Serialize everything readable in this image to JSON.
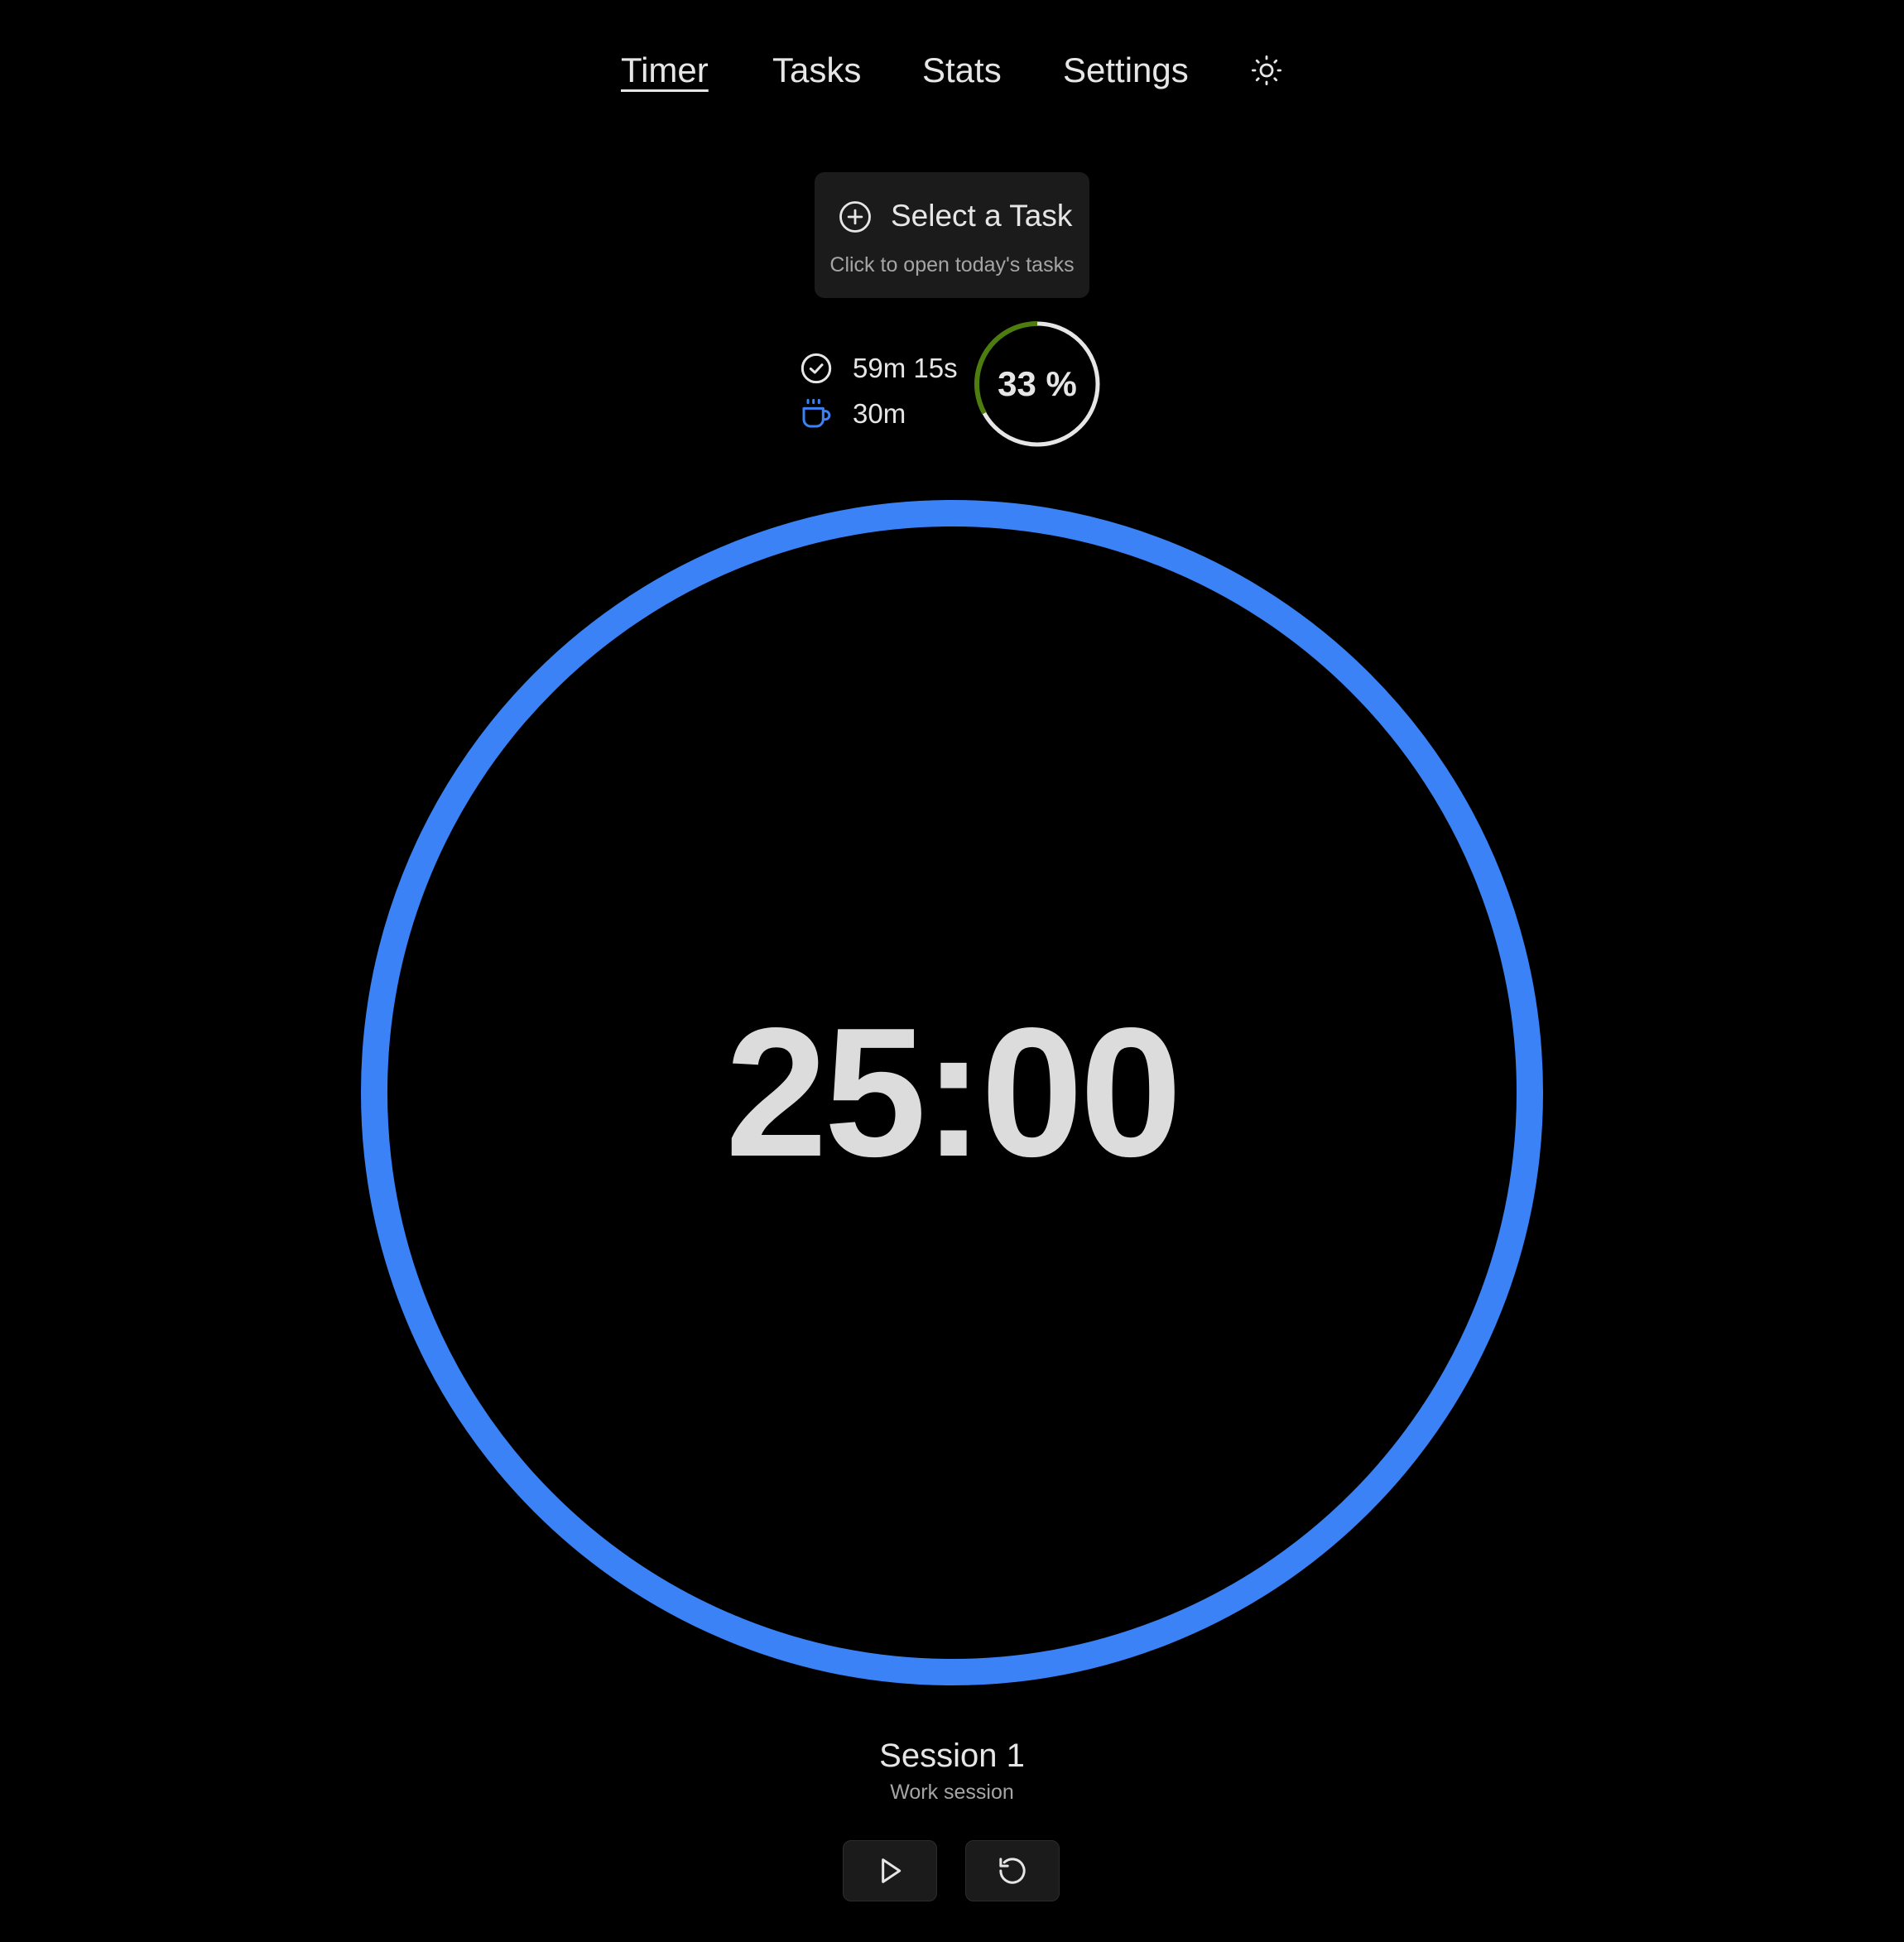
{
  "nav": {
    "items": [
      {
        "label": "Timer",
        "active": true
      },
      {
        "label": "Tasks",
        "active": false
      },
      {
        "label": "Stats",
        "active": false
      },
      {
        "label": "Settings",
        "active": false
      }
    ],
    "theme_icon": "sun-icon"
  },
  "task_selector": {
    "title": "Select a Task",
    "subtitle": "Click to open today's tasks",
    "icon": "plus-circle-icon"
  },
  "stats": {
    "focus_time": "59m 15s",
    "focus_icon": "check-circle-icon",
    "break_time": "30m",
    "break_icon": "coffee-cup-icon",
    "progress_label": "33 %",
    "progress_fraction": 0.33,
    "progress_color": "#4d7c0f",
    "ring_color": "#e6e6e6"
  },
  "timer": {
    "display": "25:00",
    "ring_color": "#3b82f6",
    "progress_fraction": 1.0
  },
  "session": {
    "title": "Session 1",
    "subtitle": "Work session"
  },
  "controls": {
    "play_icon": "play-icon",
    "reset_icon": "reset-icon"
  },
  "colors": {
    "background": "#000000",
    "accent": "#3b82f6",
    "text": "#e6e6e6",
    "muted": "#a5a5a5",
    "card": "#1b1b1b"
  }
}
